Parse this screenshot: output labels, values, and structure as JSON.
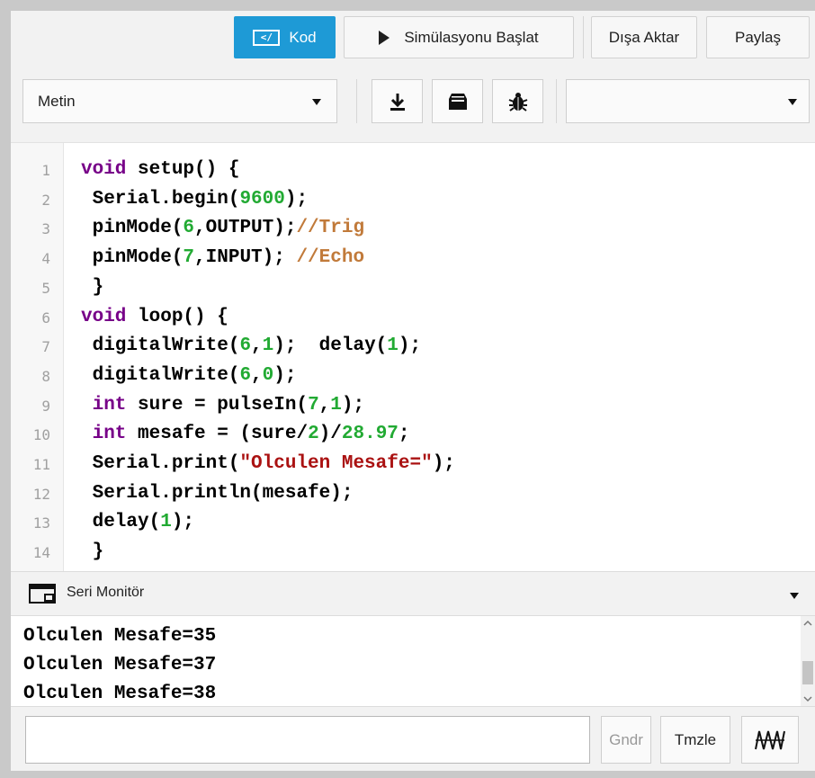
{
  "toolbar": {
    "code_label": "Kod",
    "start_simulation_label": "Simülasyonu Başlat",
    "export_label": "Dışa Aktar",
    "share_label": "Paylaş"
  },
  "editor_toolbar": {
    "mode_select_value": "Metin",
    "download_icon": "download-icon",
    "upload_icon": "upload-icon",
    "debug_icon": "bug-icon",
    "component_select_value": ""
  },
  "editor": {
    "line_numbers": [
      "1",
      "2",
      "3",
      "4",
      "5",
      "6",
      "7",
      "8",
      "9",
      "10",
      "11",
      "12",
      "13",
      "14"
    ],
    "lines": [
      [
        {
          "t": "void",
          "c": "kw"
        },
        {
          "t": " setup() {",
          "c": ""
        }
      ],
      [
        {
          "t": " Serial.begin(",
          "c": ""
        },
        {
          "t": "9600",
          "c": "num"
        },
        {
          "t": ");",
          "c": ""
        }
      ],
      [
        {
          "t": " pinMode(",
          "c": ""
        },
        {
          "t": "6",
          "c": "num"
        },
        {
          "t": ",OUTPUT);",
          "c": ""
        },
        {
          "t": "//Trig",
          "c": "cm"
        }
      ],
      [
        {
          "t": " pinMode(",
          "c": ""
        },
        {
          "t": "7",
          "c": "num"
        },
        {
          "t": ",INPUT); ",
          "c": ""
        },
        {
          "t": "//Echo",
          "c": "cm"
        }
      ],
      [
        {
          "t": " }",
          "c": ""
        }
      ],
      [
        {
          "t": "void",
          "c": "kw"
        },
        {
          "t": " loop() {",
          "c": ""
        }
      ],
      [
        {
          "t": " digitalWrite(",
          "c": ""
        },
        {
          "t": "6",
          "c": "num"
        },
        {
          "t": ",",
          "c": ""
        },
        {
          "t": "1",
          "c": "num"
        },
        {
          "t": ");  delay(",
          "c": ""
        },
        {
          "t": "1",
          "c": "num"
        },
        {
          "t": ");",
          "c": ""
        }
      ],
      [
        {
          "t": " digitalWrite(",
          "c": ""
        },
        {
          "t": "6",
          "c": "num"
        },
        {
          "t": ",",
          "c": ""
        },
        {
          "t": "0",
          "c": "num"
        },
        {
          "t": ");",
          "c": ""
        }
      ],
      [
        {
          "t": " int",
          "c": "kw"
        },
        {
          "t": " sure = pulseIn(",
          "c": ""
        },
        {
          "t": "7",
          "c": "num"
        },
        {
          "t": ",",
          "c": ""
        },
        {
          "t": "1",
          "c": "num"
        },
        {
          "t": ");",
          "c": ""
        }
      ],
      [
        {
          "t": " int",
          "c": "kw"
        },
        {
          "t": " mesafe = (sure/",
          "c": ""
        },
        {
          "t": "2",
          "c": "num"
        },
        {
          "t": ")/",
          "c": ""
        },
        {
          "t": "28.97",
          "c": "num"
        },
        {
          "t": ";",
          "c": ""
        }
      ],
      [
        {
          "t": " Serial.print(",
          "c": ""
        },
        {
          "t": "\"Olculen Mesafe=\"",
          "c": "str"
        },
        {
          "t": ");",
          "c": ""
        }
      ],
      [
        {
          "t": " Serial.println(mesafe);",
          "c": ""
        }
      ],
      [
        {
          "t": " delay(",
          "c": ""
        },
        {
          "t": "1",
          "c": "num"
        },
        {
          "t": ");",
          "c": ""
        }
      ],
      [
        {
          "t": " }",
          "c": ""
        }
      ]
    ]
  },
  "serial_monitor": {
    "title": "Seri Monitör",
    "output": [
      "Olculen Mesafe=35",
      "Olculen Mesafe=37",
      "Olculen Mesafe=38"
    ],
    "input_value": "",
    "send_label": "Gndr",
    "clear_label": "Tmzle",
    "graph_icon": "graph-icon"
  }
}
